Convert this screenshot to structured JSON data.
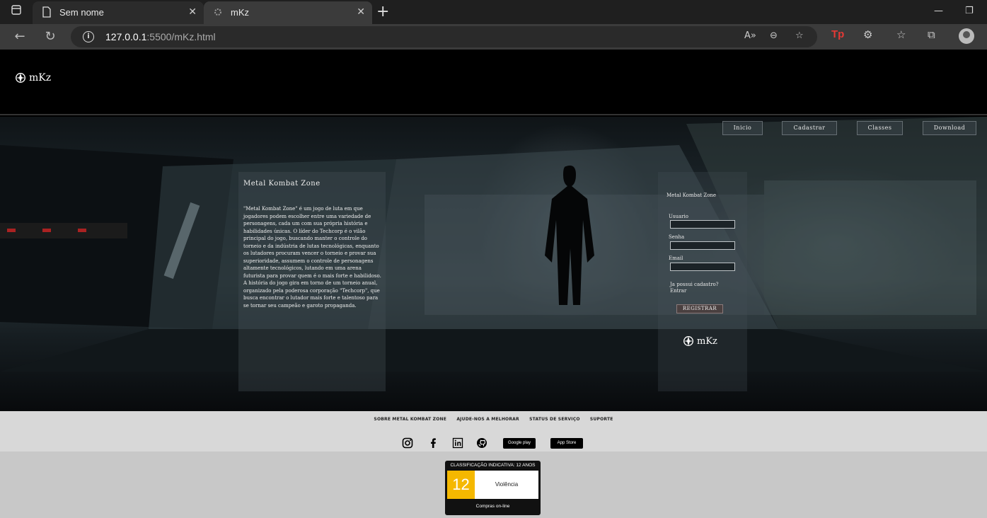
{
  "browser": {
    "tabs": [
      {
        "title": "Sem nome",
        "active": false
      },
      {
        "title": "mKz",
        "active": true
      }
    ],
    "url_host": "127.0.0.1",
    "url_path": ":5500/mKz.html",
    "tp_label": "Tp"
  },
  "site": {
    "logo_text": "mKz",
    "nav": [
      "Inicio",
      "Cadastrar",
      "Classes",
      "Download"
    ],
    "about": {
      "title": "Metal Kombat Zone",
      "text": "\"Metal Kombat Zone\" é um jogo de luta em que jogadores podem escolher entre uma variedade de personagens, cada um com sua própria história e habilidades únicas. O líder do Techcorp é o vilão principal do jogo, buscando manter o controle do torneio e da indústria de lutas tecnológicas, enquanto os lutadores procuram vencer o torneio e provar sua superioridade, assumem o controle de personagens altamente tecnológicos, lutando em uma arena futurista para provar quem é o mais forte e habilidoso. A história do jogo gira em torno de um torneio anual, organizado pela poderosa corporação \"Techcorp\", que busca encontrar o lutador mais forte e talentoso para se tornar seu campeão e garoto propaganda."
    },
    "register": {
      "title": "Metal Kombat Zone",
      "user_label": "Usuario",
      "password_label": "Senha",
      "email_label": "Email",
      "already_label": "Ja possui cadastro?",
      "login_link": "Entrar",
      "button": "REGISTRAR",
      "logo_text": "mKz"
    },
    "footer_links": [
      "SOBRE METAL KOMBAT ZONE",
      "AJUDE-NOS A MELHORAR",
      "STATUS DE SERVIÇO",
      "SUPORTE"
    ],
    "social_icons": [
      "instagram-icon",
      "facebook-icon",
      "linkedin-icon",
      "github-icon"
    ],
    "stores": [
      "Google play",
      "App Store"
    ],
    "rating": {
      "title": "CLASSIFICAÇÃO INDICATIVA: 12 ANOS",
      "age": "12",
      "descriptor": "Violência",
      "note": "Compras on-line",
      "color": "#f5b800"
    }
  }
}
